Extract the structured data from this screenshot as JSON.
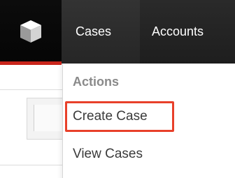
{
  "nav": {
    "logo_icon": "cube-icon",
    "tabs": [
      {
        "label": "Cases",
        "active": true
      },
      {
        "label": "Accounts",
        "active": false
      }
    ],
    "accent_color": "#c9251b"
  },
  "dropdown": {
    "header": "Actions",
    "items": [
      {
        "label": "Create Case",
        "highlighted": true
      },
      {
        "label": "View Cases",
        "highlighted": false
      }
    ],
    "highlight_color": "#e8402a"
  }
}
